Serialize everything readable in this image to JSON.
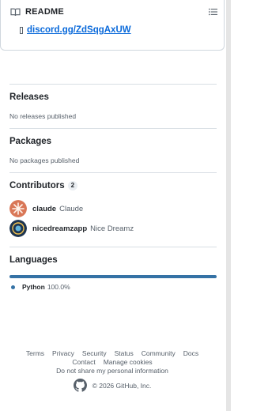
{
  "readme": {
    "title": "README",
    "link_text": "discord.gg/ZdSqgAxUW"
  },
  "releases": {
    "heading": "Releases",
    "empty_text": "No releases published"
  },
  "packages": {
    "heading": "Packages",
    "empty_text": "No packages published"
  },
  "contributors": {
    "heading": "Contributors",
    "count": "2",
    "items": [
      {
        "login": "claude",
        "name": "Claude"
      },
      {
        "login": "nicedreamzapp",
        "name": "Nice Dreamz"
      }
    ]
  },
  "languages": {
    "heading": "Languages",
    "items": [
      {
        "name": "Python",
        "percent": "100.0%",
        "share": 1.0,
        "color": "#3572A5"
      }
    ]
  },
  "footer": {
    "links_row1": [
      "Terms",
      "Privacy",
      "Security",
      "Status",
      "Community",
      "Docs"
    ],
    "links_row2": [
      "Contact",
      "Manage cookies"
    ],
    "links_row3": [
      "Do not share my personal information"
    ],
    "copyright": "© 2026 GitHub, Inc."
  },
  "icons": {
    "readme": "book-icon",
    "toc": "list-unordered-icon",
    "github": "github-mark-icon"
  }
}
